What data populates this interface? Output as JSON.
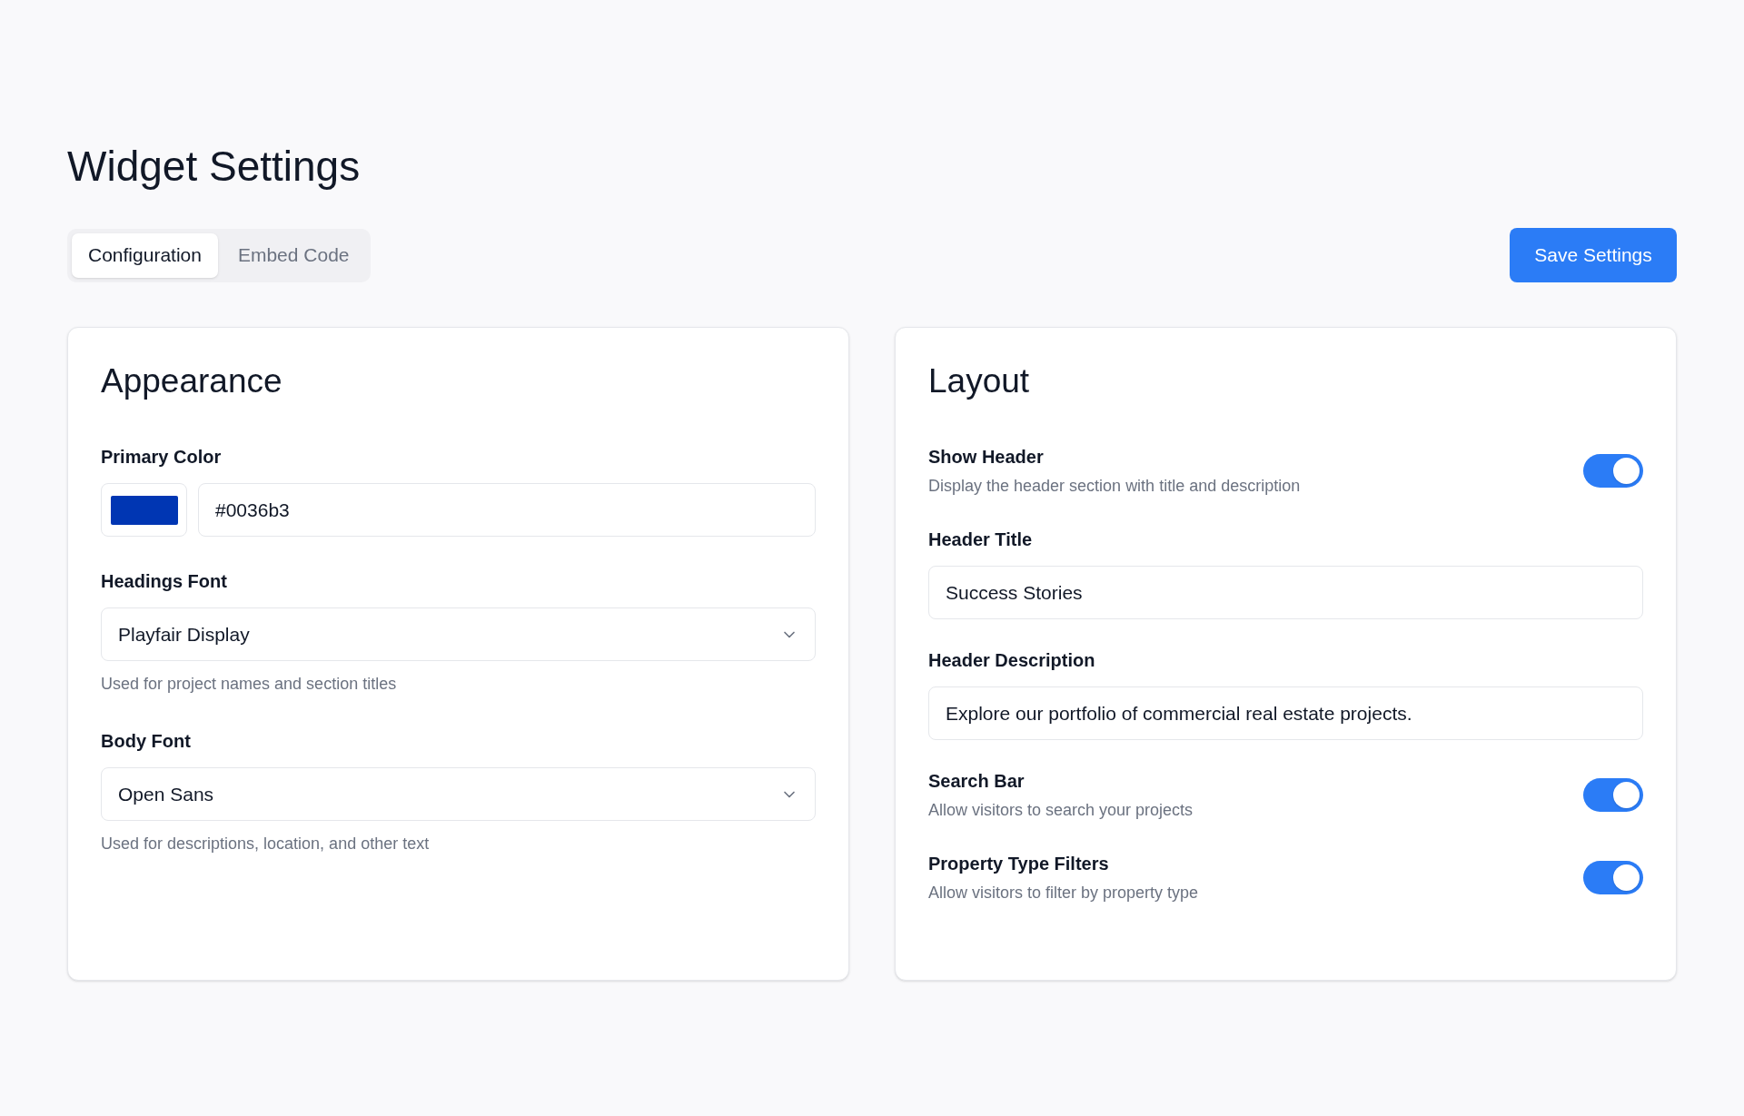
{
  "page": {
    "title": "Widget Settings"
  },
  "tabs": [
    {
      "label": "Configuration",
      "selected": true
    },
    {
      "label": "Embed Code",
      "selected": false
    }
  ],
  "save_button": "Save Settings",
  "appearance": {
    "title": "Appearance",
    "fields": [
      {
        "kind": "color",
        "label": "Primary Color",
        "color": "#0036b3",
        "value": "#0036b3"
      },
      {
        "kind": "select",
        "label": "Headings Font",
        "value": "Playfair Display",
        "help": "Used for project names and section titles"
      },
      {
        "kind": "select",
        "label": "Body Font",
        "value": "Open Sans",
        "help": "Used for descriptions, location, and other text"
      }
    ]
  },
  "layout": {
    "title": "Layout",
    "items": [
      {
        "kind": "toggle",
        "label": "Show Header",
        "description": "Display the header section with title and description",
        "on": true
      },
      {
        "kind": "text",
        "label": "Header Title",
        "value": "Success Stories"
      },
      {
        "kind": "text",
        "label": "Header Description",
        "value": "Explore our portfolio of commercial real estate projects."
      },
      {
        "kind": "toggle",
        "label": "Search Bar",
        "description": "Allow visitors to search your projects",
        "on": true
      },
      {
        "kind": "toggle",
        "label": "Property Type Filters",
        "description": "Allow visitors to filter by property type",
        "on": true
      }
    ]
  }
}
